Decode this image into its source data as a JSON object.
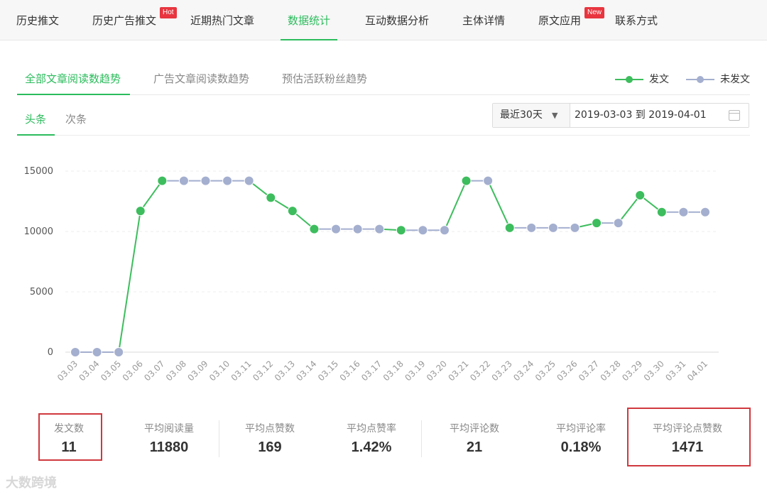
{
  "nav": {
    "tabs": [
      {
        "label": "历史推文",
        "active": false
      },
      {
        "label": "历史广告推文",
        "active": false,
        "badge": "Hot"
      },
      {
        "label": "近期热门文章",
        "active": false
      },
      {
        "label": "数据统计",
        "active": true
      },
      {
        "label": "互动数据分析",
        "active": false
      },
      {
        "label": "主体详情",
        "active": false
      },
      {
        "label": "原文应用",
        "active": false,
        "badge": "New"
      },
      {
        "label": "联系方式",
        "active": false
      }
    ]
  },
  "trend_tabs": [
    "全部文章阅读数趋势",
    "广告文章阅读数趋势",
    "预估活跃粉丝趋势"
  ],
  "legend": {
    "published": "发文",
    "not_published": "未发文"
  },
  "position_tabs": [
    "头条",
    "次条"
  ],
  "range": {
    "preset": "最近30天",
    "dates": "2019-03-03 到 2019-04-01"
  },
  "colors": {
    "accent": "#2bbc5c",
    "published": "#3dbd5d",
    "not_published": "#a4afcf",
    "highlight_box": "#d0383e"
  },
  "chart_data": {
    "type": "line",
    "categories": [
      "03.03",
      "03.04",
      "03.05",
      "03.06",
      "03.07",
      "03.08",
      "03.09",
      "03.10",
      "03.11",
      "03.12",
      "03.13",
      "03.14",
      "03.15",
      "03.16",
      "03.17",
      "03.18",
      "03.19",
      "03.20",
      "03.21",
      "03.22",
      "03.23",
      "03.24",
      "03.25",
      "03.26",
      "03.27",
      "03.28",
      "03.29",
      "03.30",
      "03.31",
      "04.01"
    ],
    "values": [
      0,
      0,
      0,
      11700,
      14200,
      14200,
      14200,
      14200,
      14200,
      12800,
      11700,
      10200,
      10200,
      10200,
      10200,
      10100,
      10100,
      10100,
      14200,
      14200,
      10300,
      10300,
      10300,
      10300,
      10700,
      10700,
      13000,
      11600,
      11600,
      11600
    ],
    "published": [
      false,
      false,
      false,
      true,
      true,
      false,
      false,
      false,
      false,
      true,
      true,
      true,
      false,
      false,
      false,
      true,
      false,
      false,
      true,
      false,
      true,
      false,
      false,
      false,
      true,
      false,
      true,
      true,
      false,
      false
    ],
    "yticks": [
      0,
      5000,
      10000,
      15000
    ],
    "ylim": [
      0,
      15000
    ],
    "grid": true
  },
  "stats": [
    {
      "label": "发文数",
      "value": "11"
    },
    {
      "label": "平均阅读量",
      "value": "11880"
    },
    {
      "label": "平均点赞数",
      "value": "169"
    },
    {
      "label": "平均点赞率",
      "value": "1.42%"
    },
    {
      "label": "平均评论数",
      "value": "21"
    },
    {
      "label": "平均评论率",
      "value": "0.18%"
    },
    {
      "label": "平均评论点赞数",
      "value": "1471"
    }
  ],
  "watermark": "大数跨境"
}
